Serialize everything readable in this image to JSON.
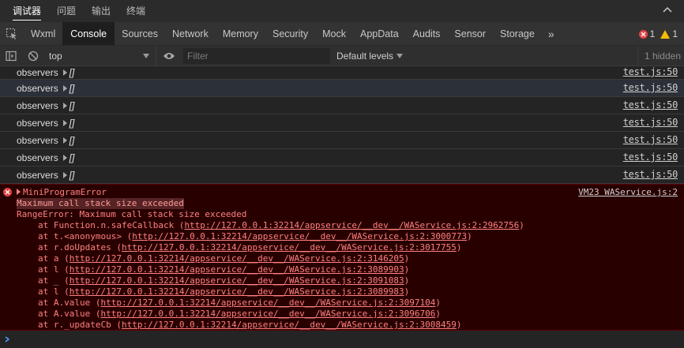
{
  "panel_tabs": [
    "调试器",
    "问题",
    "输出",
    "终端"
  ],
  "dev_tabs": [
    "Wxml",
    "Console",
    "Sources",
    "Network",
    "Memory",
    "Security",
    "Mock",
    "AppData",
    "Audits",
    "Sensor",
    "Storage"
  ],
  "more_tabs_label": "»",
  "counts": {
    "errors": "1",
    "warnings": "1"
  },
  "toolbar": {
    "context": "top",
    "filter_placeholder": "Filter",
    "levels": "Default levels",
    "hidden": "1 hidden"
  },
  "log_rows": [
    {
      "msg": "observers",
      "value": "[]",
      "source": "test.js:50"
    },
    {
      "msg": "observers",
      "value": "[]",
      "source": "test.js:50"
    },
    {
      "msg": "observers",
      "value": "[]",
      "source": "test.js:50"
    },
    {
      "msg": "observers",
      "value": "[]",
      "source": "test.js:50"
    },
    {
      "msg": "observers",
      "value": "[]",
      "source": "test.js:50"
    },
    {
      "msg": "observers",
      "value": "[]",
      "source": "test.js:50"
    },
    {
      "msg": "observers",
      "value": "[]",
      "source": "test.js:50"
    }
  ],
  "error": {
    "title": "MiniProgramError",
    "source": "VM23 WAService.js:2",
    "message": "Maximum call stack size exceeded",
    "range_error": "RangeError: Maximum call stack size exceeded",
    "stack": [
      {
        "prefix": "at Function.n.safeCallback (",
        "url": "http://127.0.0.1:32214/appservice/__dev__/WAService.js:2:2962756",
        "suffix": ")"
      },
      {
        "prefix": "at t.<anonymous> (",
        "url": "http://127.0.0.1:32214/appservice/__dev__/WAService.js:2:3000773",
        "suffix": ")"
      },
      {
        "prefix": "at r.doUpdates (",
        "url": "http://127.0.0.1:32214/appservice/__dev__/WAService.js:2:3017755",
        "suffix": ")"
      },
      {
        "prefix": "at a (",
        "url": "http://127.0.0.1:32214/appservice/__dev__/WAService.js:2:3146205",
        "suffix": ")"
      },
      {
        "prefix": "at l (",
        "url": "http://127.0.0.1:32214/appservice/__dev__/WAService.js:2:3089903",
        "suffix": ")"
      },
      {
        "prefix": "at _ (",
        "url": "http://127.0.0.1:32214/appservice/__dev__/WAService.js:2:3091083",
        "suffix": ")"
      },
      {
        "prefix": "at l (",
        "url": "http://127.0.0.1:32214/appservice/__dev__/WAService.js:2:3089983",
        "suffix": ")"
      },
      {
        "prefix": "at A.value (",
        "url": "http://127.0.0.1:32214/appservice/__dev__/WAService.js:2:3097104",
        "suffix": ")"
      },
      {
        "prefix": "at A.value (",
        "url": "http://127.0.0.1:32214/appservice/__dev__/WAService.js:2:3096706",
        "suffix": ")"
      },
      {
        "prefix": "at r._updateCb (",
        "url": "http://127.0.0.1:32214/appservice/__dev__/WAService.js:2:3008459",
        "suffix": ")"
      }
    ]
  },
  "prompt_symbol": "›",
  "colors": {
    "error": "#ff8080",
    "error_bg": "#290000",
    "accent_blue": "#4a9cff"
  }
}
